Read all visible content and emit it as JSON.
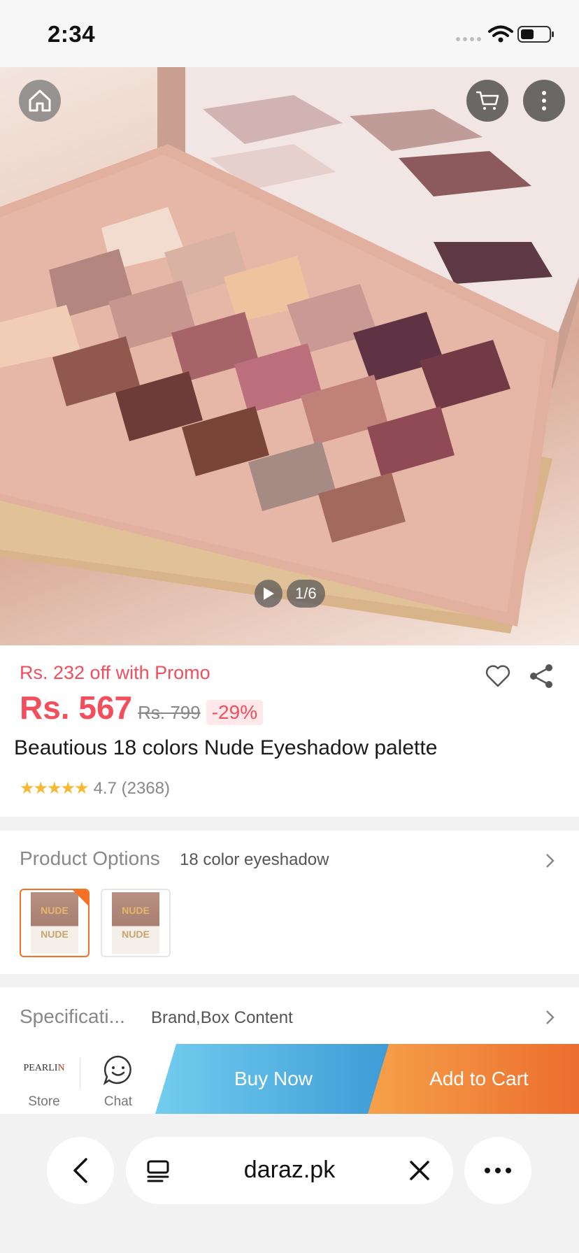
{
  "status_bar": {
    "time": "2:34"
  },
  "gallery": {
    "counter": "1/6"
  },
  "product": {
    "promo_text": "Rs. 232 off with Promo",
    "price": "Rs. 567",
    "old_price": "Rs. 799",
    "discount": "-29%",
    "title": "Beautious 18 colors Nude Eyeshadow palette",
    "stars": "★★★★★",
    "rating_text": "4.7 (2368)",
    "rating_value": 4.7
  },
  "options": {
    "label": "Product Options",
    "value": "18 color eyeshadow",
    "thumbnails": [
      {
        "top_text": "NUDE",
        "bottom_text": "NUDE",
        "selected": true
      },
      {
        "top_text": "NUDE",
        "bottom_text": "NUDE",
        "selected": false
      }
    ]
  },
  "specification": {
    "label": "Specificati...",
    "value": "Brand,Box Content"
  },
  "action_bar": {
    "store_logo_main": "PEARLI",
    "store_logo_accent": "N",
    "store_label": "Store",
    "chat_label": "Chat",
    "buy_now": "Buy Now",
    "add_to_cart": "Add to Cart"
  },
  "browser": {
    "url": "daraz.pk"
  },
  "colors": {
    "price_red": "#f24e5b",
    "buy_now_start": "#72cdee",
    "buy_now_end": "#3e9bd6",
    "add_cart_start": "#f5a14a",
    "add_cart_end": "#ed6d2e",
    "option_selected": "#f57224",
    "star": "#f8b932"
  }
}
